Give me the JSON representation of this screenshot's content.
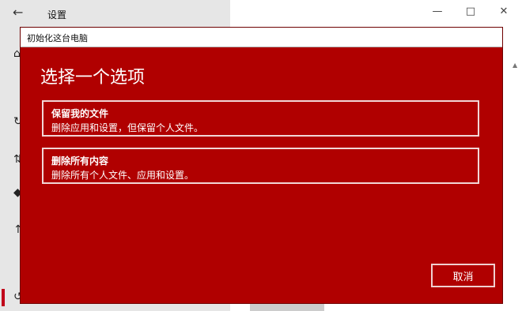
{
  "settings": {
    "title": "设置",
    "nav_icons": [
      "home-icon",
      "update-icon",
      "delivery-icon",
      "security-icon",
      "backup-icon",
      "recovery-icon"
    ]
  },
  "dialog": {
    "title": "初始化这台电脑",
    "heading": "选择一个选项",
    "options": [
      {
        "title": "保留我的文件",
        "description": "删除应用和设置，但保留个人文件。"
      },
      {
        "title": "删除所有内容",
        "description": "删除所有个人文件、应用和设置。"
      }
    ],
    "cancel_label": "取消",
    "accent_color": "#b00000"
  }
}
